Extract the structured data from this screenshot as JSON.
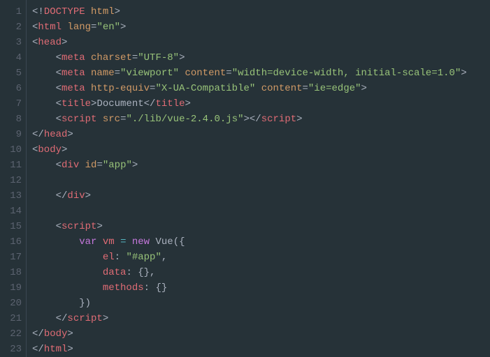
{
  "lineNumbers": [
    "1",
    "2",
    "3",
    "4",
    "5",
    "6",
    "7",
    "8",
    "9",
    "10",
    "11",
    "12",
    "13",
    "14",
    "15",
    "16",
    "17",
    "18",
    "19",
    "20",
    "21",
    "22",
    "23"
  ],
  "code": {
    "l1": [
      [
        "p",
        "<!"
      ],
      [
        "tg",
        "DOCTYPE"
      ],
      [
        "p",
        " "
      ],
      [
        "at",
        "html"
      ],
      [
        "p",
        ">"
      ]
    ],
    "l2": [
      [
        "p",
        "<"
      ],
      [
        "tg",
        "html"
      ],
      [
        "p",
        " "
      ],
      [
        "at",
        "lang"
      ],
      [
        "p",
        "="
      ],
      [
        "st",
        "\"en\""
      ],
      [
        "p",
        ">"
      ]
    ],
    "l3": [
      [
        "p",
        "<"
      ],
      [
        "tg",
        "head"
      ],
      [
        "p",
        ">"
      ]
    ],
    "l4": [
      [
        "p",
        "    <"
      ],
      [
        "tg",
        "meta"
      ],
      [
        "p",
        " "
      ],
      [
        "at",
        "charset"
      ],
      [
        "p",
        "="
      ],
      [
        "st",
        "\"UTF-8\""
      ],
      [
        "p",
        ">"
      ]
    ],
    "l5": [
      [
        "p",
        "    <"
      ],
      [
        "tg",
        "meta"
      ],
      [
        "p",
        " "
      ],
      [
        "at",
        "name"
      ],
      [
        "p",
        "="
      ],
      [
        "st",
        "\"viewport\""
      ],
      [
        "p",
        " "
      ],
      [
        "at",
        "content"
      ],
      [
        "p",
        "="
      ],
      [
        "st",
        "\"width=device-width, initial-scale=1.0\""
      ],
      [
        "p",
        ">"
      ]
    ],
    "l6": [
      [
        "p",
        "    <"
      ],
      [
        "tg",
        "meta"
      ],
      [
        "p",
        " "
      ],
      [
        "at",
        "http-equiv"
      ],
      [
        "p",
        "="
      ],
      [
        "st",
        "\"X-UA-Compatible\""
      ],
      [
        "p",
        " "
      ],
      [
        "at",
        "content"
      ],
      [
        "p",
        "="
      ],
      [
        "st",
        "\"ie=edge\""
      ],
      [
        "p",
        ">"
      ]
    ],
    "l7": [
      [
        "p",
        "    <"
      ],
      [
        "tg",
        "title"
      ],
      [
        "p",
        ">"
      ],
      [
        "tx",
        "Document"
      ],
      [
        "p",
        "</"
      ],
      [
        "tg",
        "title"
      ],
      [
        "p",
        ">"
      ]
    ],
    "l8": [
      [
        "p",
        "    <"
      ],
      [
        "tg",
        "script"
      ],
      [
        "p",
        " "
      ],
      [
        "at",
        "src"
      ],
      [
        "p",
        "="
      ],
      [
        "st",
        "\"./lib/vue-2.4.0.js\""
      ],
      [
        "p",
        "></"
      ],
      [
        "tg",
        "script"
      ],
      [
        "p",
        ">"
      ]
    ],
    "l9": [
      [
        "p",
        "</"
      ],
      [
        "tg",
        "head"
      ],
      [
        "p",
        ">"
      ]
    ],
    "l10": [
      [
        "p",
        "<"
      ],
      [
        "tg",
        "body"
      ],
      [
        "p",
        ">"
      ]
    ],
    "l11": [
      [
        "p",
        "    <"
      ],
      [
        "tg",
        "div"
      ],
      [
        "p",
        " "
      ],
      [
        "at",
        "id"
      ],
      [
        "p",
        "="
      ],
      [
        "st",
        "\"app\""
      ],
      [
        "p",
        ">"
      ]
    ],
    "l12": [
      [
        "p",
        ""
      ]
    ],
    "l13": [
      [
        "p",
        "    </"
      ],
      [
        "tg",
        "div"
      ],
      [
        "p",
        ">"
      ]
    ],
    "l14": [
      [
        "p",
        ""
      ]
    ],
    "l15": [
      [
        "p",
        "    <"
      ],
      [
        "tg",
        "script"
      ],
      [
        "p",
        ">"
      ]
    ],
    "l16": [
      [
        "tx",
        "        "
      ],
      [
        "kw",
        "var"
      ],
      [
        "tx",
        " "
      ],
      [
        "vr",
        "vm"
      ],
      [
        "tx",
        " "
      ],
      [
        "op",
        "="
      ],
      [
        "tx",
        " "
      ],
      [
        "kw",
        "new"
      ],
      [
        "tx",
        " Vue({"
      ]
    ],
    "l17": [
      [
        "tx",
        "            "
      ],
      [
        "vr",
        "el"
      ],
      [
        "tx",
        ": "
      ],
      [
        "st",
        "\"#app\""
      ],
      [
        "tx",
        ","
      ]
    ],
    "l18": [
      [
        "tx",
        "            "
      ],
      [
        "vr",
        "data"
      ],
      [
        "tx",
        ": {},"
      ]
    ],
    "l19": [
      [
        "tx",
        "            "
      ],
      [
        "vr",
        "methods"
      ],
      [
        "tx",
        ": {}"
      ]
    ],
    "l20": [
      [
        "tx",
        "        })"
      ]
    ],
    "l21": [
      [
        "p",
        "    </"
      ],
      [
        "tg",
        "script"
      ],
      [
        "p",
        ">"
      ]
    ],
    "l22": [
      [
        "p",
        "</"
      ],
      [
        "tg",
        "body"
      ],
      [
        "p",
        ">"
      ]
    ],
    "l23": [
      [
        "p",
        "</"
      ],
      [
        "tg",
        "html"
      ],
      [
        "p",
        ">"
      ]
    ]
  }
}
